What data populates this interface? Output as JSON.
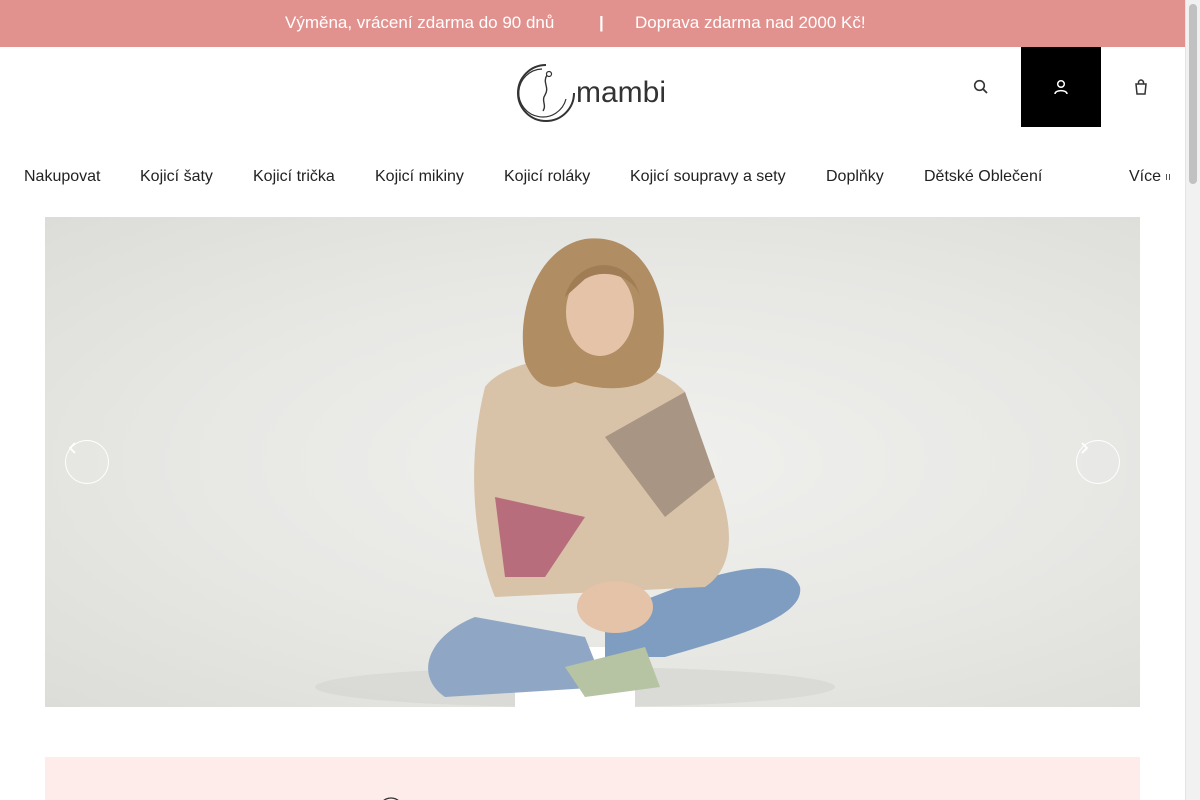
{
  "announcement": {
    "message_1": "Výměna, vrácení zdarma do 90 dnů",
    "separator": "|",
    "message_2": "Doprava zdarma nad 2000 Kč!"
  },
  "brand": {
    "logo_text": "mambi"
  },
  "header_icons": [
    "search-icon",
    "account-icon",
    "cart-icon"
  ],
  "nav": {
    "items": [
      "Nakupovat",
      "Kojicí šaty",
      "Kojicí trička",
      "Kojicí mikiny",
      "Kojicí roláky",
      "Kojicí soupravy a sety",
      "Doplňky",
      "Dětské Oblečení"
    ],
    "more_label": "Více"
  },
  "hero": {
    "slides_visible": 1
  },
  "colors": {
    "accent": "#e2928e",
    "benefits_background": "#fdecea",
    "account_button": "#000000"
  }
}
